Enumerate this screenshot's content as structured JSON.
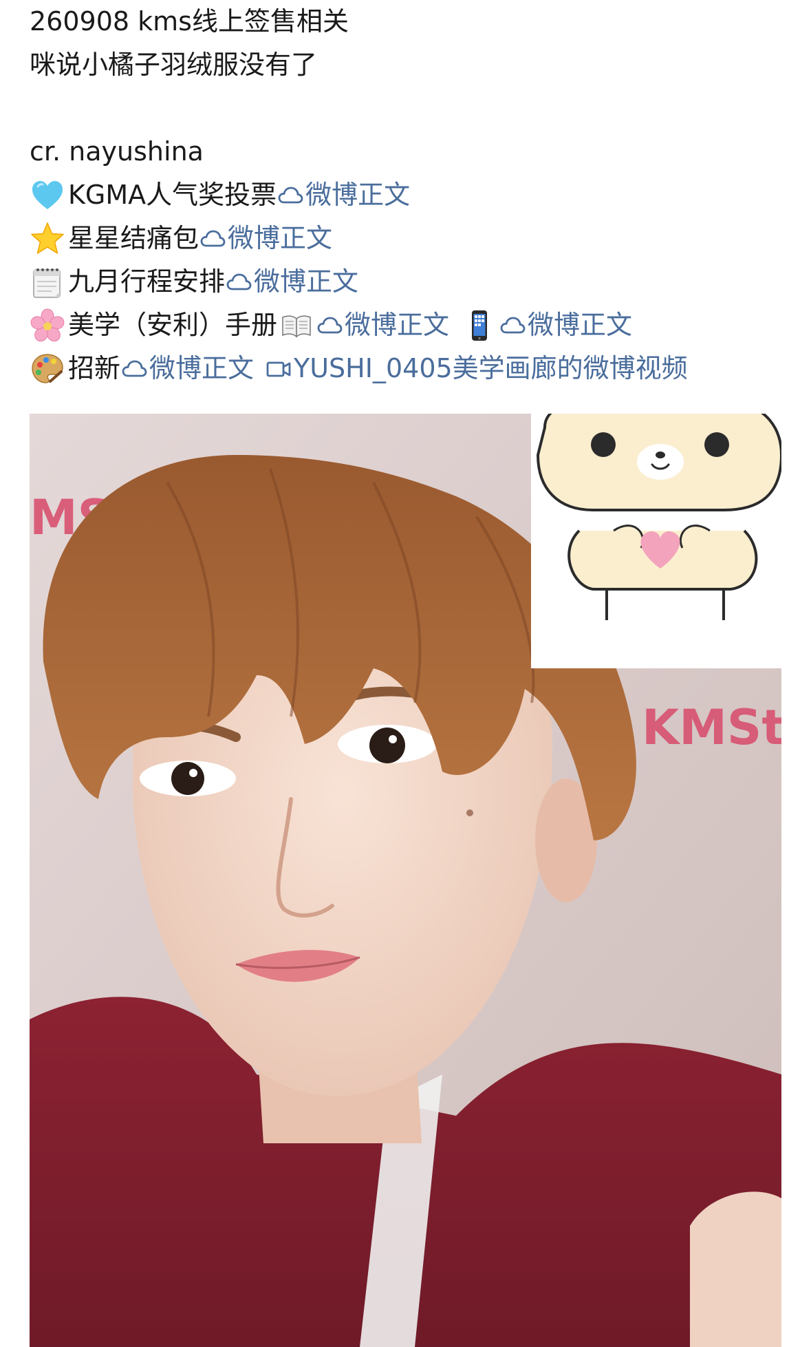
{
  "post": {
    "lines": {
      "title": "260908 kms线上签售相关",
      "subtitle": "咪说小橘子羽绒服没有了",
      "credit": "cr. nayushina"
    },
    "entries": [
      {
        "emoji": "blue-heart",
        "label": "KGMA人气奖投票",
        "links": [
          {
            "icon": "weibo-cloud-icon",
            "text": "微博正文"
          }
        ]
      },
      {
        "emoji": "star",
        "label": "星星结痛包",
        "links": [
          {
            "icon": "weibo-cloud-icon",
            "text": "微博正文"
          }
        ]
      },
      {
        "emoji": "calendar",
        "label": "九月行程安排",
        "links": [
          {
            "icon": "weibo-cloud-icon",
            "text": "微博正文"
          }
        ]
      },
      {
        "emoji": "cherry-blossom",
        "label": "美学（安利）手册",
        "links": [
          {
            "prefix_emoji": "open-book",
            "icon": "weibo-cloud-icon",
            "text": "微博正文"
          },
          {
            "prefix_emoji": "mobile-phone",
            "icon": "weibo-cloud-icon",
            "text": "微博正文"
          }
        ]
      },
      {
        "emoji": "palette",
        "label": "招新",
        "links": [
          {
            "icon": "weibo-cloud-icon",
            "text": "微博正文"
          },
          {
            "icon": "video-icon",
            "text": "YUSHI_0405美学画廊的微博视频"
          }
        ]
      }
    ]
  },
  "colors": {
    "link": "#4a6d9c",
    "text": "#1a1a1a"
  }
}
